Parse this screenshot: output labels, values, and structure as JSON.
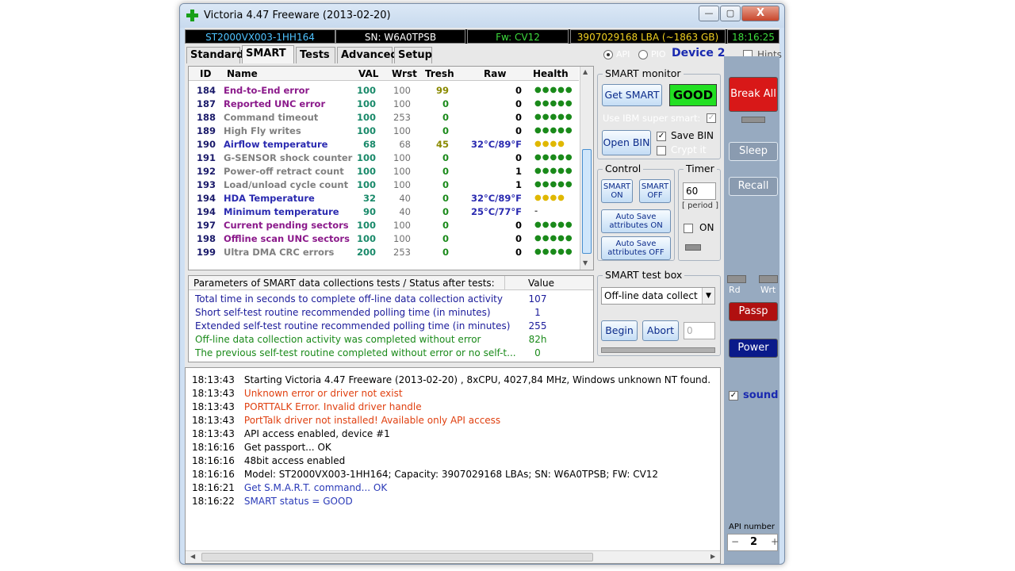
{
  "window": {
    "title": "Victoria 4.47  Freeware (2013-02-20)",
    "min_label": "—",
    "max_label": "▢",
    "close_label": "X"
  },
  "infobar": {
    "model": "ST2000VX003-1HH164",
    "serial": "SN: W6A0TPSB",
    "firmware": "Fw: CV12",
    "lba": "3907029168 LBA (~1863 GB)",
    "time": "18:16:25"
  },
  "tabs": [
    "Standard",
    "SMART",
    "Tests",
    "Advanced",
    "Setup"
  ],
  "mode": {
    "api": "API",
    "pio": "PIO",
    "device": "Device 2",
    "hints": "Hints"
  },
  "smart_table": {
    "headers": [
      "ID",
      "Name",
      "VAL",
      "Wrst",
      "Tresh",
      "Raw",
      "Health"
    ],
    "rows": [
      {
        "id": "184",
        "name": "End-to-End error",
        "val": "100",
        "wrst": "100",
        "tresh": "99",
        "raw": "0",
        "health": "●●●●●",
        "color": "#8b1a8b",
        "hcolor": "#1a8a1a"
      },
      {
        "id": "187",
        "name": "Reported UNC error",
        "val": "100",
        "wrst": "100",
        "tresh": "0",
        "raw": "0",
        "health": "●●●●●",
        "color": "#8b1a8b",
        "hcolor": "#1a8a1a"
      },
      {
        "id": "188",
        "name": "Command timeout",
        "val": "100",
        "wrst": "253",
        "tresh": "0",
        "raw": "0",
        "health": "●●●●●",
        "color": "#808080",
        "hcolor": "#1a8a1a"
      },
      {
        "id": "189",
        "name": "High Fly writes",
        "val": "100",
        "wrst": "100",
        "tresh": "0",
        "raw": "0",
        "health": "●●●●●",
        "color": "#808080",
        "hcolor": "#1a8a1a"
      },
      {
        "id": "190",
        "name": "Airflow temperature",
        "val": "68",
        "wrst": "68",
        "tresh": "45",
        "raw": "32°C/89°F",
        "health": "●●●●",
        "color": "#2a2ab0",
        "hcolor": "#e0b800"
      },
      {
        "id": "191",
        "name": "G-SENSOR shock counter",
        "val": "100",
        "wrst": "100",
        "tresh": "0",
        "raw": "0",
        "health": "●●●●●",
        "color": "#808080",
        "hcolor": "#1a8a1a"
      },
      {
        "id": "192",
        "name": "Power-off retract count",
        "val": "100",
        "wrst": "100",
        "tresh": "0",
        "raw": "1",
        "health": "●●●●●",
        "color": "#808080",
        "hcolor": "#1a8a1a"
      },
      {
        "id": "193",
        "name": "Load/unload cycle count",
        "val": "100",
        "wrst": "100",
        "tresh": "0",
        "raw": "1",
        "health": "●●●●●",
        "color": "#808080",
        "hcolor": "#1a8a1a"
      },
      {
        "id": "194",
        "name": "HDA Temperature",
        "val": "32",
        "wrst": "40",
        "tresh": "0",
        "raw": "32°C/89°F",
        "health": "●●●●",
        "color": "#2a2ab0",
        "hcolor": "#e0b800"
      },
      {
        "id": "194",
        "name": "Minimum temperature",
        "val": "90",
        "wrst": "40",
        "tresh": "0",
        "raw": "25°C/77°F",
        "health": "-",
        "color": "#2a2ab0",
        "hcolor": "#555555"
      },
      {
        "id": "197",
        "name": "Current pending sectors",
        "val": "100",
        "wrst": "100",
        "tresh": "0",
        "raw": "0",
        "health": "●●●●●",
        "color": "#8b1a8b",
        "hcolor": "#1a8a1a"
      },
      {
        "id": "198",
        "name": "Offline scan UNC sectors",
        "val": "100",
        "wrst": "100",
        "tresh": "0",
        "raw": "0",
        "health": "●●●●●",
        "color": "#8b1a8b",
        "hcolor": "#1a8a1a"
      },
      {
        "id": "199",
        "name": "Ultra DMA CRC errors",
        "val": "200",
        "wrst": "253",
        "tresh": "0",
        "raw": "0",
        "health": "●●●●●",
        "color": "#808080",
        "hcolor": "#1a8a1a"
      }
    ]
  },
  "params": {
    "header": "Parameters of SMART data collections tests / Status after tests:",
    "value_header": "Value",
    "rows": [
      {
        "text": "Total time in seconds to complete off-line data collection activity",
        "value": "107",
        "color": "#1a1a9a"
      },
      {
        "text": "Short self-test routine recommended polling time (in minutes)",
        "value": "1",
        "color": "#1a1a9a"
      },
      {
        "text": "Extended self-test routine recommended polling time (in minutes)",
        "value": "255",
        "color": "#1a1a9a"
      },
      {
        "text": "Off-line data collection activity was completed without error",
        "value": "82h",
        "color": "#1a8a1a"
      },
      {
        "text": "The previous self-test routine completed without error or no self-t...",
        "value": "0",
        "color": "#1a8a1a"
      }
    ]
  },
  "log": [
    {
      "time": "18:13:43",
      "text": "Starting Victoria 4.47  Freeware (2013-02-20) , 8xCPU, 4027,84 MHz, Windows unknown NT found.",
      "color": "#000000"
    },
    {
      "time": "18:13:43",
      "text": "Unknown error or driver not exist",
      "color": "#e04010"
    },
    {
      "time": "18:13:43",
      "text": "PORTTALK Error. Invalid driver handle",
      "color": "#e04010"
    },
    {
      "time": "18:13:43",
      "text": "PortTalk driver not installed! Available only API access",
      "color": "#e04010"
    },
    {
      "time": "18:13:43",
      "text": "API access enabled, device #1",
      "color": "#000000"
    },
    {
      "time": "18:16:16",
      "text": "Get passport... OK",
      "color": "#000000"
    },
    {
      "time": "18:16:16",
      "text": "48bit access enabled",
      "color": "#000000"
    },
    {
      "time": "18:16:16",
      "text": "Model: ST2000VX003-1HH164; Capacity: 3907029168 LBAs; SN: W6A0TPSB; FW: CV12",
      "color": "#000000"
    },
    {
      "time": "18:16:21",
      "text": "Get S.M.A.R.T. command... OK",
      "color": "#2a3ab8"
    },
    {
      "time": "18:16:22",
      "text": "SMART status = GOOD",
      "color": "#2a3ab8"
    }
  ],
  "smart_monitor": {
    "label": "SMART monitor",
    "get_smart": "Get SMART",
    "status": "GOOD",
    "ibm": "Use IBM super smart:",
    "open_bin": "Open BIN",
    "save_bin": "Save BIN",
    "crypt": "Crypt it"
  },
  "control": {
    "label": "Control",
    "smart_on": "SMART ON",
    "smart_off": "SMART OFF",
    "autosave_on": "Auto Save attributes ON",
    "autosave_off": "Auto Save attributes OFF"
  },
  "timer": {
    "label": "Timer",
    "value": "60",
    "period": "[ period ]",
    "on": "ON"
  },
  "test_box": {
    "label": "SMART test box",
    "selected": "Off-line data collect",
    "begin": "Begin",
    "abort": "Abort",
    "count": "0"
  },
  "side": {
    "break_all": "Break All",
    "sleep": "Sleep",
    "recall": "Recall",
    "rd": "Rd",
    "wrt": "Wrt",
    "passp": "Passp",
    "power": "Power",
    "sound": "sound",
    "api_number_label": "API number",
    "api_number": "2",
    "minus": "−",
    "plus": "+"
  },
  "colors": {
    "good": "#22e022",
    "break": "#d81818",
    "passp": "#b01010",
    "power": "#0a1a8a"
  }
}
